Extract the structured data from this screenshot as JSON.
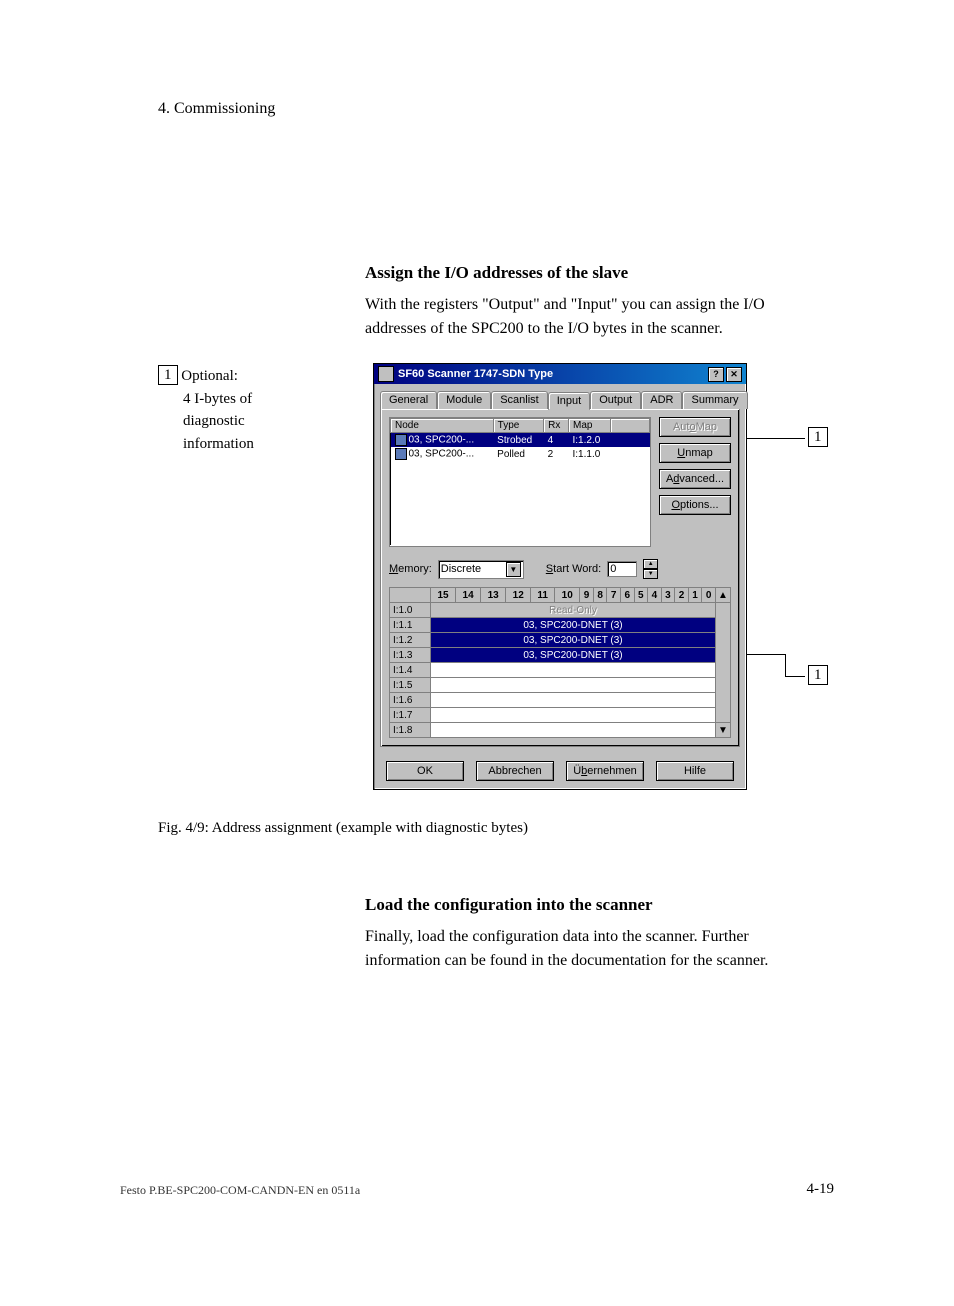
{
  "header": "4.   Commissioning",
  "section1": {
    "heading": "Assign the I/O addresses of the slave",
    "para": "With the registers \"Output\" and \"Input\" you can assign the I/O addresses of the SPC200 to the I/O bytes in the scanner."
  },
  "left_annotation": {
    "num": "1",
    "l1": "Optional:",
    "l2": "4 I-bytes of",
    "l3": "diagnostic",
    "l4": "information"
  },
  "dialog": {
    "title": "SF60 Scanner 1747-SDN Type",
    "help_btn": "?",
    "close_btn": "✕",
    "tabs": [
      "General",
      "Module",
      "Scanlist",
      "Input",
      "Output",
      "ADR",
      "Summary"
    ],
    "active_tab": "Input",
    "nodetable": {
      "headers": [
        "Node",
        "Type",
        "Rx",
        "Map"
      ],
      "rows": [
        {
          "node": "03, SPC200-...",
          "type": "Strobed",
          "rx": "4",
          "map": "I:1.2.0",
          "selected": true
        },
        {
          "node": "03, SPC200-...",
          "type": "Polled",
          "rx": "2",
          "map": "I:1.1.0",
          "selected": false
        }
      ]
    },
    "side_buttons": {
      "automap": "AutoMap",
      "unmap": "Unmap",
      "advanced": "Advanced...",
      "options": "Options..."
    },
    "memory_label": "Memory:",
    "memory_value": "Discrete",
    "startword_label": "Start Word:",
    "startword_value": "0",
    "bit_headers": [
      "15",
      "14",
      "13",
      "12",
      "11",
      "10",
      "9",
      "8",
      "7",
      "6",
      "5",
      "4",
      "3",
      "2",
      "1",
      "0"
    ],
    "bit_rows": [
      {
        "label": "I:1.0",
        "content": "Read-Only",
        "readonly": true,
        "selected": false
      },
      {
        "label": "I:1.1",
        "content": "03, SPC200-DNET (3)",
        "readonly": false,
        "selected": true
      },
      {
        "label": "I:1.2",
        "content": "03, SPC200-DNET (3)",
        "readonly": false,
        "selected": true
      },
      {
        "label": "I:1.3",
        "content": "03, SPC200-DNET (3)",
        "readonly": false,
        "selected": true
      },
      {
        "label": "I:1.4",
        "content": "",
        "readonly": false,
        "selected": false
      },
      {
        "label": "I:1.5",
        "content": "",
        "readonly": false,
        "selected": false
      },
      {
        "label": "I:1.6",
        "content": "",
        "readonly": false,
        "selected": false
      },
      {
        "label": "I:1.7",
        "content": "",
        "readonly": false,
        "selected": false
      },
      {
        "label": "I:1.8",
        "content": "",
        "readonly": false,
        "selected": false
      }
    ],
    "bottom_buttons": {
      "ok": "OK",
      "cancel": "Abbrechen",
      "apply": "Übernehmen",
      "help": "Hilfe"
    }
  },
  "callout_right": "1",
  "figure_caption": "Fig. 4/9:    Address assignment (example with diagnostic bytes)",
  "section2": {
    "heading": "Load the configuration into the scanner",
    "para": "Finally, load the configuration data into the scanner. Further information can be found in the documentation for the scanner."
  },
  "footer_left": "Festo P.BE-SPC200-COM-CANDN-EN en 0511a",
  "footer_right": "4-19"
}
